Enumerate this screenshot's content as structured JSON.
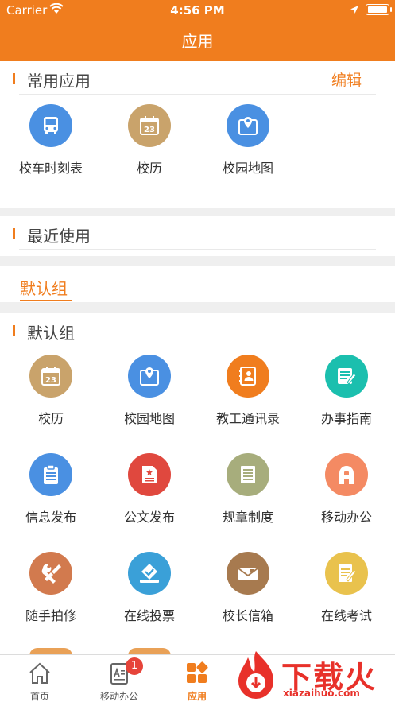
{
  "status_bar": {
    "carrier": "Carrier",
    "time": "4:56 PM"
  },
  "header": {
    "title": "应用"
  },
  "frequent": {
    "title": "常用应用",
    "edit_label": "编辑",
    "apps": [
      {
        "label": "校车时刻表",
        "icon": "bus-icon",
        "color": "#4a90e2"
      },
      {
        "label": "校历",
        "icon": "calendar-icon",
        "color": "#c9a36b"
      },
      {
        "label": "校园地图",
        "icon": "map-icon",
        "color": "#4a90e2"
      }
    ]
  },
  "recent": {
    "title": "最近使用"
  },
  "group_tabs": {
    "active": "默认组"
  },
  "default_group": {
    "title": "默认组",
    "apps": [
      {
        "label": "校历",
        "icon": "calendar-icon",
        "color": "#c9a36b"
      },
      {
        "label": "校园地图",
        "icon": "map-icon",
        "color": "#4a90e2"
      },
      {
        "label": "教工通讯录",
        "icon": "contacts-icon",
        "color": "#f07d1e"
      },
      {
        "label": "办事指南",
        "icon": "guide-icon",
        "color": "#1bbfae"
      },
      {
        "label": "信息发布",
        "icon": "clipboard-icon",
        "color": "#4a90e2"
      },
      {
        "label": "公文发布",
        "icon": "document-icon",
        "color": "#e0483e"
      },
      {
        "label": "规章制度",
        "icon": "rules-icon",
        "color": "#a7ad7c"
      },
      {
        "label": "移动办公",
        "icon": "mobile-office-icon",
        "color": "#f48a63"
      },
      {
        "label": "随手拍修",
        "icon": "repair-icon",
        "color": "#d27a4e"
      },
      {
        "label": "在线投票",
        "icon": "vote-icon",
        "color": "#3aa0d8"
      },
      {
        "label": "校长信箱",
        "icon": "mailbox-icon",
        "color": "#a77a4f"
      },
      {
        "label": "在线考试",
        "icon": "exam-icon",
        "color": "#e9c24d"
      }
    ]
  },
  "bottom_nav": {
    "items": [
      {
        "label": "首页",
        "icon": "home-icon"
      },
      {
        "label": "移动办公",
        "icon": "office-icon",
        "badge": "1"
      },
      {
        "label": "应用",
        "icon": "apps-icon"
      }
    ]
  },
  "watermark": {
    "text": "下载火",
    "url": "xiazaihuo.com"
  },
  "colors": {
    "accent": "#f07d1e",
    "background": "#efefef"
  }
}
